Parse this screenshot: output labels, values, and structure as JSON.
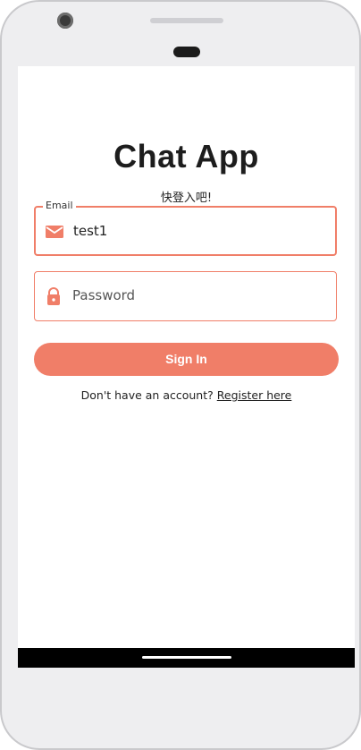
{
  "app": {
    "title": "Chat App",
    "subtitle": "快登入吧!"
  },
  "email": {
    "label": "Email",
    "value": "test1",
    "icon": "mail-icon"
  },
  "password": {
    "placeholder": "Password",
    "icon": "lock-icon"
  },
  "actions": {
    "sign_in_label": "Sign In",
    "register_prompt": "Don't have an account?",
    "register_link": "Register here"
  },
  "colors": {
    "accent": "#f07e68",
    "text": "#1d1d1d",
    "nav_bar": "#000000"
  }
}
